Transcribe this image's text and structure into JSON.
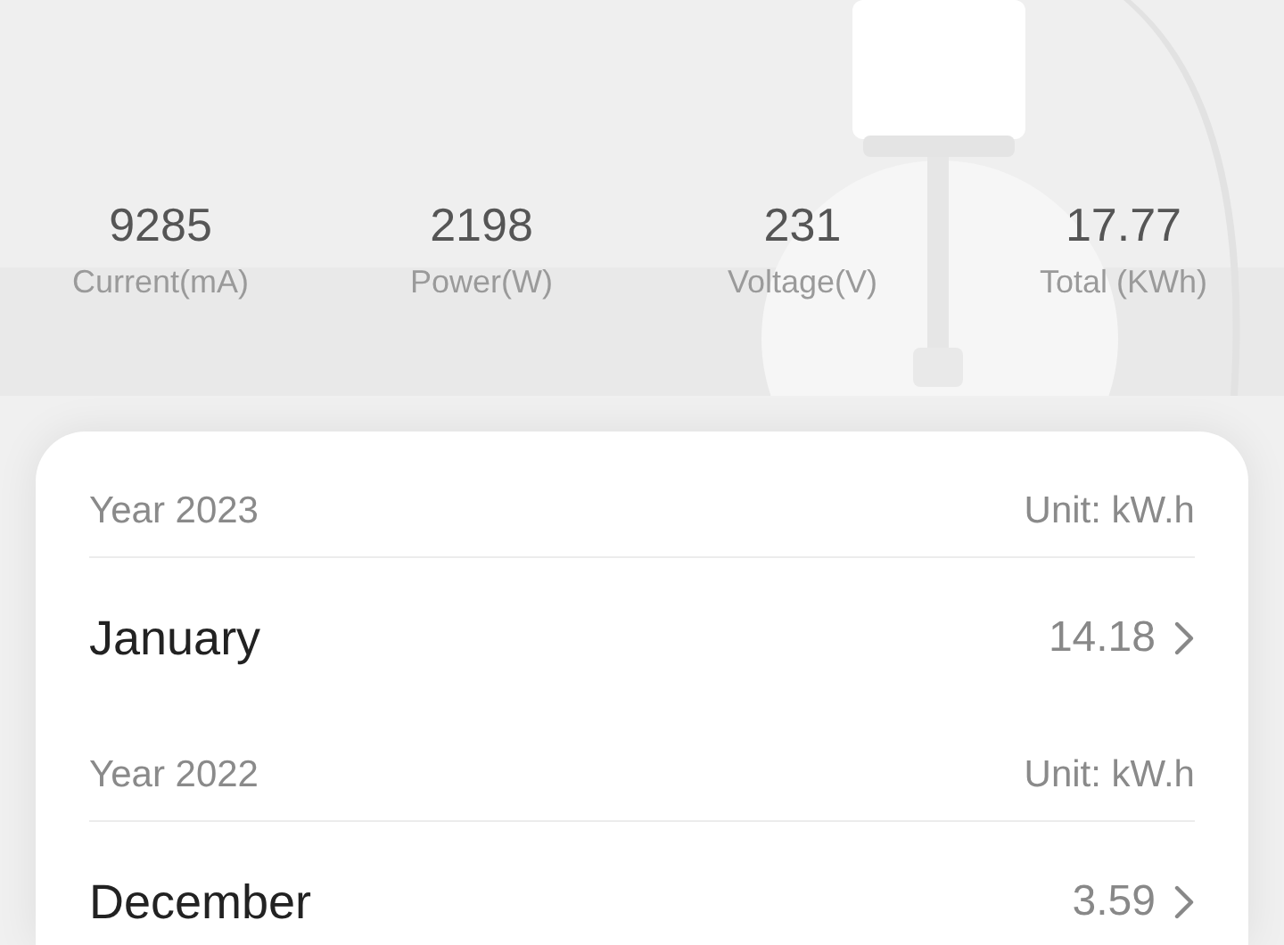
{
  "stats": [
    {
      "value": "9285",
      "label": "Current(mA)"
    },
    {
      "value": "2198",
      "label": "Power(W)"
    },
    {
      "value": "231",
      "label": "Voltage(V)"
    },
    {
      "value": "17.77",
      "label": "Total (KWh)"
    }
  ],
  "sections": [
    {
      "year": "Year 2023",
      "unit": "Unit: kW.h",
      "rows": [
        {
          "month": "January",
          "value": "14.18"
        }
      ]
    },
    {
      "year": "Year 2022",
      "unit": "Unit: kW.h",
      "rows": [
        {
          "month": "December",
          "value": "3.59"
        }
      ]
    }
  ]
}
